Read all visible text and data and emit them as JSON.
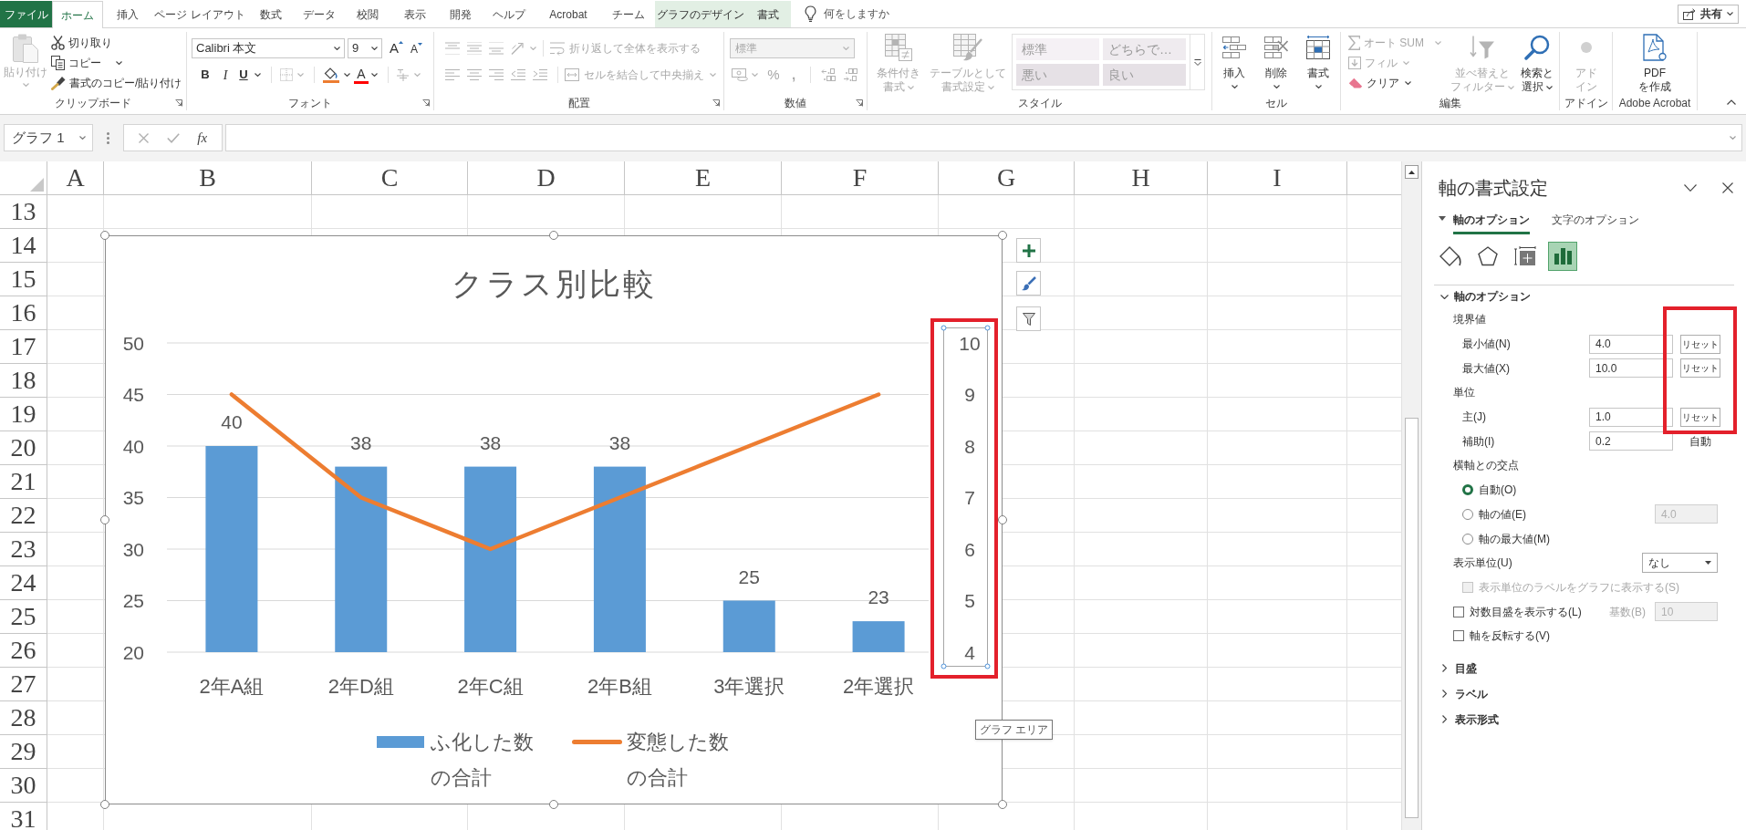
{
  "ribbon": {
    "tabs": [
      {
        "label": "ファイル",
        "kind": "file",
        "selected": false
      },
      {
        "label": "ホーム",
        "kind": "normal",
        "selected": true
      },
      {
        "label": "挿入",
        "kind": "normal",
        "selected": false
      },
      {
        "label": "ページ レイアウト",
        "kind": "normal",
        "selected": false
      },
      {
        "label": "数式",
        "kind": "normal",
        "selected": false
      },
      {
        "label": "データ",
        "kind": "normal",
        "selected": false
      },
      {
        "label": "校閲",
        "kind": "normal",
        "selected": false
      },
      {
        "label": "表示",
        "kind": "normal",
        "selected": false
      },
      {
        "label": "開発",
        "kind": "normal",
        "selected": false
      },
      {
        "label": "ヘルプ",
        "kind": "normal",
        "selected": false
      },
      {
        "label": "Acrobat",
        "kind": "normal",
        "selected": false
      },
      {
        "label": "チーム",
        "kind": "normal",
        "selected": false
      },
      {
        "label": "グラフのデザイン",
        "kind": "contextual",
        "selected": false
      },
      {
        "label": "書式",
        "kind": "contextual",
        "selected": false
      }
    ],
    "tell_me": "何をしますか",
    "share": "共有",
    "groups": [
      {
        "kind": "clipboard",
        "label": "クリップボード",
        "launcher": true,
        "paste": {
          "label": "貼り付け",
          "disabled": true
        },
        "items": [
          {
            "kind": "cut",
            "label": "切り取り",
            "disabled": false
          },
          {
            "kind": "copy",
            "label": "コピー",
            "disabled": false
          },
          {
            "kind": "format_painter",
            "label": "書式のコピー/貼り付け",
            "disabled": false
          }
        ]
      },
      {
        "kind": "font",
        "label": "フォント",
        "launcher": true,
        "font_name": "Calibri 本文",
        "font_size": "9",
        "grow": "A",
        "shrink": "A",
        "tools": [
          {
            "kind": "bold",
            "label": "B",
            "disabled": false
          },
          {
            "kind": "italic",
            "label": "I",
            "disabled": false
          },
          {
            "kind": "underline",
            "label": "U",
            "disabled": false
          },
          {
            "kind": "borders",
            "disabled": true
          },
          {
            "kind": "fill_color",
            "disabled": false
          },
          {
            "kind": "font_color",
            "label": "A",
            "disabled": false
          },
          {
            "kind": "phonetic",
            "disabled": true
          }
        ]
      },
      {
        "kind": "alignment",
        "label": "配置",
        "launcher": true,
        "disabled": true,
        "wrap_text": "折り返して全体を表示する",
        "merge": "セルを結合して中央揃え"
      },
      {
        "kind": "number",
        "label": "数値",
        "launcher": true,
        "disabled": true,
        "format": "標準",
        "percent": "%",
        "comma": ","
      },
      {
        "kind": "styles",
        "label": "スタイル",
        "disabled": true,
        "buttons": [
          {
            "kind": "conditional",
            "lines": [
              "条件付き",
              "書式"
            ]
          },
          {
            "kind": "table",
            "lines": [
              "テーブルとして",
              "書式設定"
            ]
          }
        ],
        "gallery": [
          {
            "kind": "normal",
            "label": "標準"
          },
          {
            "kind": "neutral",
            "label": "どちらで…"
          },
          {
            "kind": "bad",
            "label": "悪い"
          },
          {
            "kind": "good",
            "label": "良い"
          }
        ]
      },
      {
        "kind": "cells",
        "label": "セル",
        "buttons": [
          {
            "kind": "insert",
            "lines": [
              "挿入"
            ],
            "disabled": false
          },
          {
            "kind": "delete",
            "lines": [
              "削除"
            ],
            "disabled": false
          },
          {
            "kind": "format",
            "lines": [
              "書式"
            ],
            "disabled": false
          }
        ]
      },
      {
        "kind": "editing",
        "label": "編集",
        "items": [
          {
            "kind": "sum",
            "label": "オート SUM",
            "disabled": true
          },
          {
            "kind": "fill",
            "label": "フィル",
            "disabled": true
          },
          {
            "kind": "clear",
            "label": "クリア",
            "disabled": false
          }
        ],
        "buttons": [
          {
            "kind": "sort",
            "lines": [
              "並べ替えと",
              "フィルター"
            ],
            "disabled": true
          },
          {
            "kind": "find",
            "lines": [
              "検索と",
              "選択"
            ],
            "disabled": false
          }
        ]
      },
      {
        "kind": "addins",
        "label": "アドイン",
        "buttons": [
          {
            "kind": "addin",
            "lines": [
              "アド",
              "イン"
            ],
            "disabled": true
          }
        ]
      },
      {
        "kind": "acrobat",
        "label": "Adobe Acrobat",
        "buttons": [
          {
            "kind": "pdf",
            "lines": [
              "PDF",
              "を作成"
            ],
            "disabled": false
          }
        ]
      }
    ]
  },
  "formula_bar": {
    "name_box": "グラフ 1",
    "function_label": "fx"
  },
  "sheet": {
    "columns": [
      "A",
      "B",
      "C",
      "D",
      "E",
      "F",
      "G",
      "H",
      "I"
    ],
    "rows": [
      "13",
      "14",
      "15",
      "16",
      "17",
      "18",
      "19",
      "20",
      "21",
      "22",
      "23",
      "24",
      "25",
      "26",
      "27",
      "28",
      "29",
      "30",
      "31"
    ]
  },
  "chart": {
    "selected": true,
    "tooltip": "グラフ エリア",
    "secondary_axis": {
      "selected": true,
      "highlighted": true
    },
    "chart_data": {
      "type": "bar",
      "title": "クラス別比較",
      "categories": [
        "2年A組",
        "2年D組",
        "2年C組",
        "2年B組",
        "3年選択",
        "2年選択"
      ],
      "series": [
        {
          "name": "ふ化した数の合計",
          "color": "#5b9bd5",
          "values": [
            40,
            38,
            38,
            38,
            25,
            23
          ],
          "value_labels": [
            "40",
            "38",
            "38",
            "38",
            "25",
            "23"
          ]
        },
        {
          "name": "変態した数の合計",
          "type": "line",
          "axis": "y2",
          "color": "#ed7d31",
          "values": [
            9,
            7,
            6,
            7,
            8,
            9
          ]
        }
      ],
      "ylim": [
        20,
        50
      ],
      "yticks": [
        {
          "value": 20,
          "label": "20"
        },
        {
          "value": 25,
          "label": "25"
        },
        {
          "value": 30,
          "label": "30"
        },
        {
          "value": 35,
          "label": "35"
        },
        {
          "value": 40,
          "label": "40"
        },
        {
          "value": 45,
          "label": "45"
        },
        {
          "value": 50,
          "label": "50"
        }
      ],
      "y2lim": [
        4,
        10
      ],
      "y2ticks": [
        {
          "value": 4,
          "label": "4"
        },
        {
          "value": 5,
          "label": "5"
        },
        {
          "value": 6,
          "label": "6"
        },
        {
          "value": 7,
          "label": "7"
        },
        {
          "value": 8,
          "label": "8"
        },
        {
          "value": 9,
          "label": "9"
        },
        {
          "value": 10,
          "label": "10"
        }
      ],
      "grid": true,
      "legend": "bottom"
    }
  },
  "format_pane": {
    "title": "軸の書式設定",
    "tabs": [
      {
        "label": "軸のオプション",
        "selected": true
      },
      {
        "label": "文字のオプション",
        "selected": false
      }
    ],
    "icon_tabs": [
      {
        "kind": "fill_line",
        "selected": false
      },
      {
        "kind": "effects",
        "selected": false
      },
      {
        "kind": "size_properties",
        "selected": false
      },
      {
        "kind": "axis_options",
        "selected": true
      }
    ],
    "reset_highlighted": true,
    "sections": [
      {
        "title": "軸のオプション",
        "expanded": true,
        "items": [
          {
            "kind": "group",
            "label": "境界値",
            "children": [
              {
                "kind": "field",
                "label": "最小値(N)",
                "value": "4.0",
                "button": "リセット"
              },
              {
                "kind": "field",
                "label": "最大値(X)",
                "value": "10.0",
                "button": "リセット"
              }
            ]
          },
          {
            "kind": "group",
            "label": "単位",
            "children": [
              {
                "kind": "field",
                "label": "主(J)",
                "value": "1.0",
                "button": "リセット"
              },
              {
                "kind": "field",
                "label": "補助(I)",
                "value": "0.2",
                "note": "自動"
              }
            ]
          },
          {
            "kind": "group",
            "label": "横軸との交点",
            "children": [
              {
                "kind": "radio",
                "label": "自動(O)",
                "selected": true
              },
              {
                "kind": "radio",
                "label": "軸の値(E)",
                "selected": false,
                "value": "4.0",
                "value_disabled": true
              },
              {
                "kind": "radio",
                "label": "軸の最大値(M)",
                "selected": false
              }
            ]
          },
          {
            "kind": "dropdown",
            "label": "表示単位(U)",
            "value": "なし",
            "children": [
              {
                "kind": "checkbox",
                "label": "表示単位のラベルをグラフに表示する(S)",
                "checked": false,
                "disabled": true
              }
            ]
          },
          {
            "kind": "checkbox",
            "label": "対数目盛を表示する(L)",
            "checked": false,
            "disabled": false,
            "base_label": "基数(B)",
            "value": "10",
            "base_disabled": true
          },
          {
            "kind": "checkbox",
            "label": "軸を反転する(V)",
            "checked": false,
            "disabled": false
          }
        ]
      },
      {
        "title": "目盛",
        "expanded": false
      },
      {
        "title": "ラベル",
        "expanded": false
      },
      {
        "title": "表示形式",
        "expanded": false
      }
    ]
  }
}
